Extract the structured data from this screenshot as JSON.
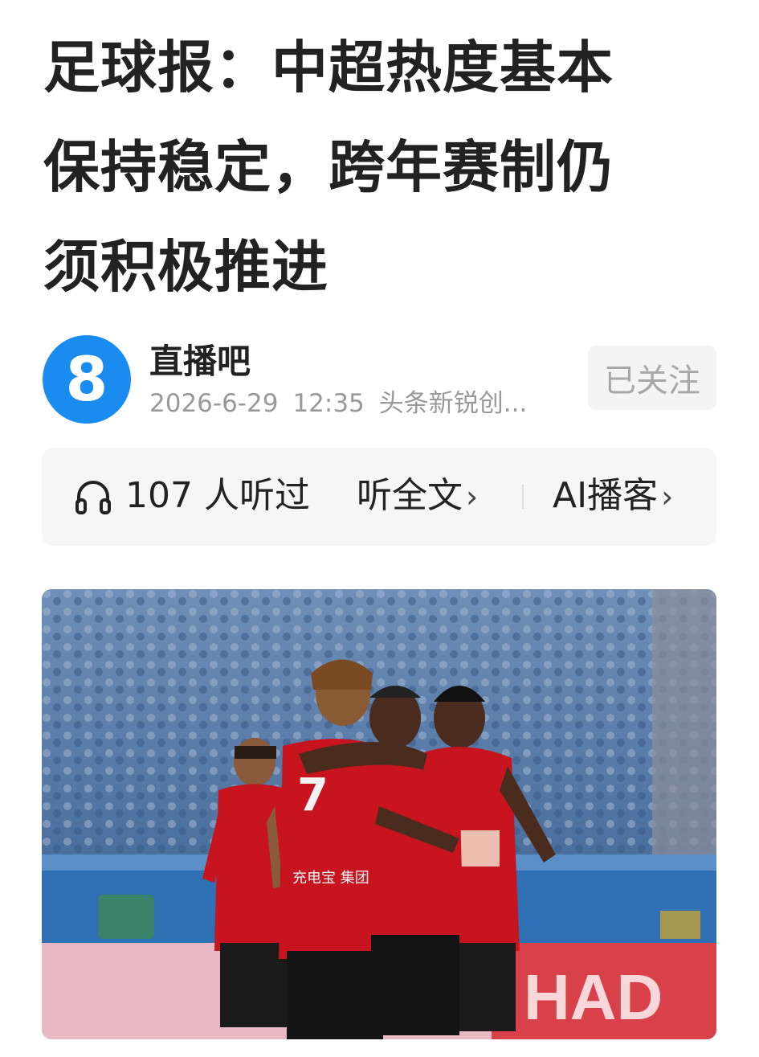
{
  "article": {
    "title_line1": "足球报：中超热度基本",
    "title_line2": "保持稳定，跨年赛制仍",
    "title_line3": "须积极推进"
  },
  "author": {
    "avatar_text": "8",
    "name": "直播吧",
    "date": "2026-6-29",
    "time": "12:35",
    "source": "头条新锐创...",
    "follow_label": "已关注"
  },
  "listen": {
    "icon": "headphones-icon",
    "count": "107 人听过",
    "full_text_label": "听全文",
    "ai_label": "AI播客",
    "chevron": "›"
  },
  "photo": {
    "jersey_sponsor": "充电宝 集团",
    "jersey_number": "7",
    "ad_board_text": "HAD"
  },
  "colors": {
    "avatar_blue": "#1a8cf0",
    "jersey_red": "#c8141e",
    "crowd_blue": "#5b7fae",
    "text_gray": "#999999"
  }
}
